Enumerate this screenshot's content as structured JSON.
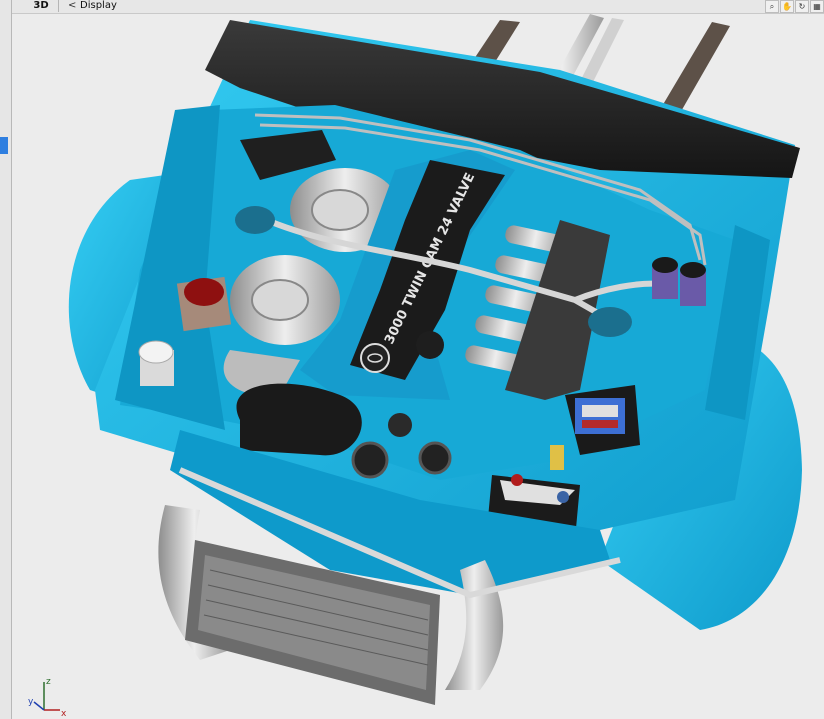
{
  "toolbar": {
    "view_tab": "3D",
    "back_glyph": "<",
    "menu_label": "Display",
    "tools": [
      {
        "icon": "zoom-icon",
        "glyph": "⌕"
      },
      {
        "icon": "pan-hand-icon",
        "glyph": "✋"
      },
      {
        "icon": "rotate-icon",
        "glyph": "↻"
      },
      {
        "icon": "select-icon",
        "glyph": "▦"
      }
    ]
  },
  "viewport": {
    "engine_cover_text": "3000 TWIN CAM 24 VALVE",
    "axis": {
      "x": "x",
      "y": "y",
      "z": "z"
    }
  },
  "colors": {
    "body_blue": "#16b4e2",
    "body_dark": "#0b86b0",
    "metal": "#c9c9c9",
    "background": "#ececec"
  }
}
